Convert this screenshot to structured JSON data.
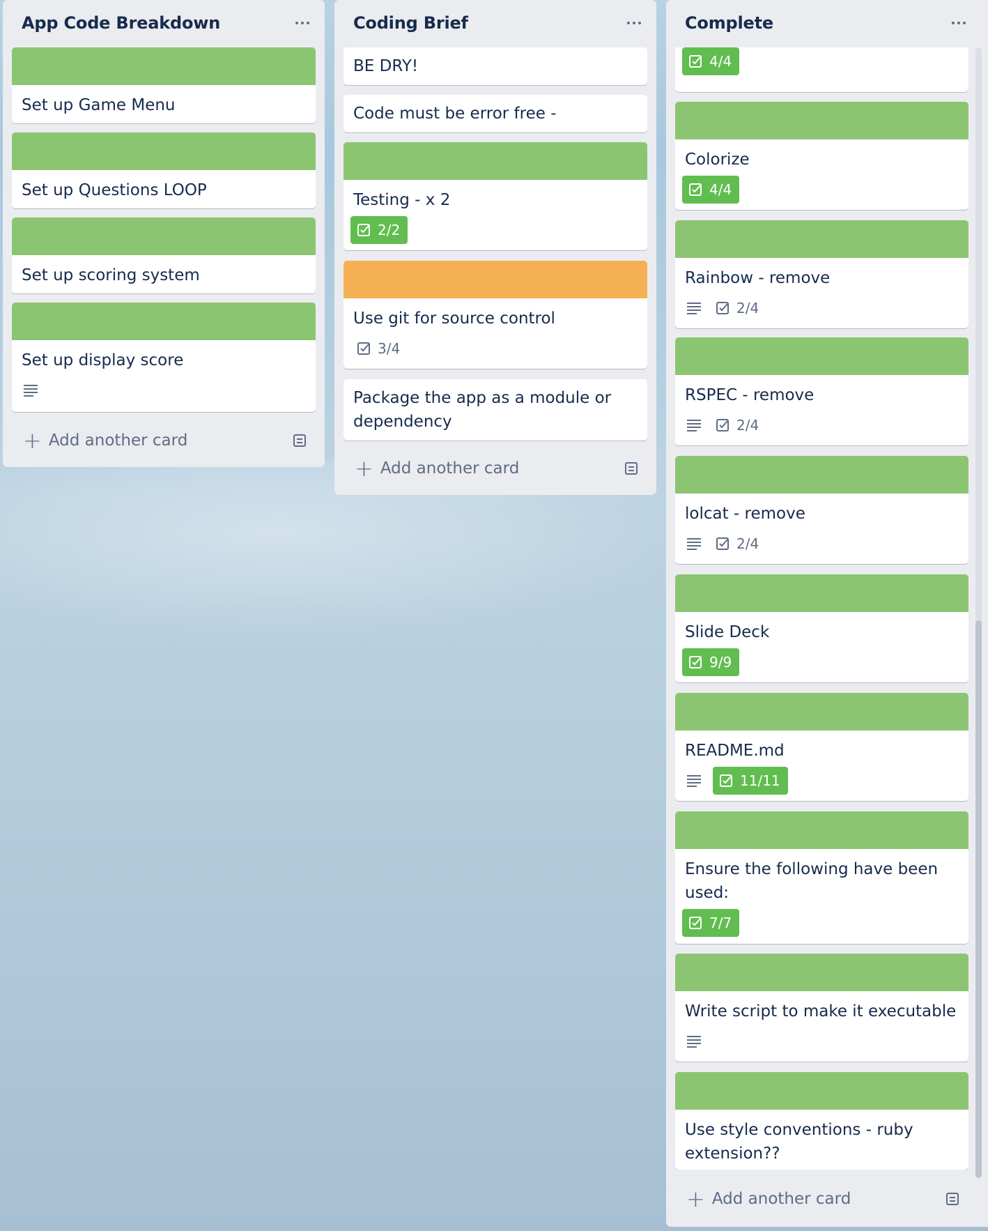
{
  "lists": [
    {
      "title": "App Code Breakdown",
      "add_card": "Add another card",
      "cards": [
        {
          "title": "Set up Game Menu",
          "cover": "#8cc572"
        },
        {
          "title": "Set up Questions LOOP",
          "cover": "#8cc572"
        },
        {
          "title": "Set up scoring system",
          "cover": "#8cc572"
        },
        {
          "title": "Set up display score",
          "cover": "#8cc572",
          "has_description": true
        }
      ]
    },
    {
      "title": "Coding Brief",
      "add_card": "Add another card",
      "cards": [
        {
          "title": "BE DRY!"
        },
        {
          "title": "Code must be error free -"
        },
        {
          "title": "Testing - x 2",
          "cover": "#8cc572",
          "checklist": "2/2",
          "checklist_complete": true
        },
        {
          "title": "Use git for source control",
          "cover": "#f5b054",
          "checklist": "3/4",
          "checklist_complete": false
        },
        {
          "title": "Package the app as a module or dependency"
        }
      ]
    },
    {
      "title": "Complete",
      "add_card": "Add another card",
      "cards": [
        {
          "title": "",
          "checklist": "4/4",
          "checklist_complete": true
        },
        {
          "title": "Colorize",
          "cover": "#8cc572",
          "checklist": "4/4",
          "checklist_complete": true
        },
        {
          "title": "Rainbow - remove",
          "cover": "#8cc572",
          "has_description": true,
          "checklist": "2/4",
          "checklist_complete": false
        },
        {
          "title": "RSPEC - remove",
          "cover": "#8cc572",
          "has_description": true,
          "checklist": "2/4",
          "checklist_complete": false
        },
        {
          "title": "lolcat - remove",
          "cover": "#8cc572",
          "has_description": true,
          "checklist": "2/4",
          "checklist_complete": false
        },
        {
          "title": "Slide Deck",
          "cover": "#8cc572",
          "checklist": "9/9",
          "checklist_complete": true
        },
        {
          "title": "README.md",
          "cover": "#8cc572",
          "has_description": true,
          "checklist": "11/11",
          "checklist_complete": true
        },
        {
          "title": "Ensure the following have been used:",
          "cover": "#8cc572",
          "checklist": "7/7",
          "checklist_complete": true
        },
        {
          "title": "Write script to make it executable",
          "cover": "#8cc572",
          "has_description": true
        },
        {
          "title": "Use style conventions - ruby extension??",
          "cover": "#8cc572"
        }
      ]
    }
  ],
  "icons": {
    "list_menu": "ellipsis-icon",
    "checklist": "checkbox-icon",
    "description": "description-icon",
    "add": "plus-icon",
    "template": "card-template-icon"
  },
  "colors": {
    "list_bg": "#ebecf0",
    "green_cover": "#8cc572",
    "orange_cover": "#f5b054",
    "badge_complete": "#61bd4f",
    "text": "#172b4d",
    "muted": "#5e6c84"
  }
}
